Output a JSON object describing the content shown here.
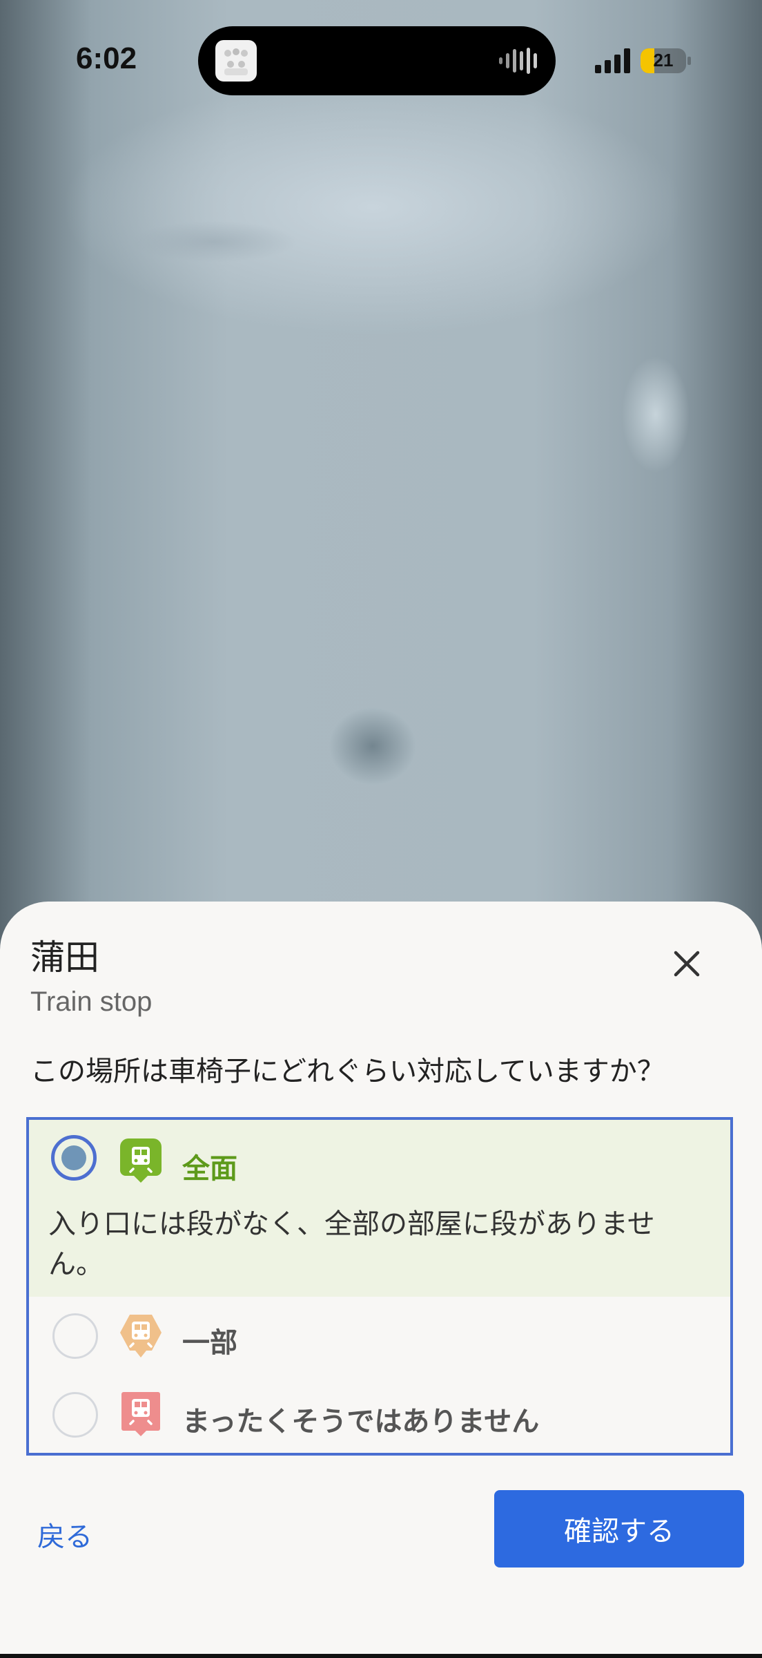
{
  "status_bar": {
    "time": "6:02",
    "battery_level": "21",
    "battery_color": "#f5c400"
  },
  "sheet": {
    "place_name": "蒲田",
    "place_type": "Train stop",
    "close_icon": "close-icon",
    "question": "この場所は車椅子にどれぐらい対応していますか？",
    "options": [
      {
        "label": "全面",
        "description": "入り口には段がなく、全部の部屋に段がありません。",
        "selected": true,
        "icon": "train-icon-green",
        "color": "#5d9a1a"
      },
      {
        "label": "一部",
        "selected": false,
        "icon": "train-icon-orange",
        "color": "#ecb275"
      },
      {
        "label": "まったくそうではありません",
        "selected": false,
        "icon": "train-icon-red",
        "color": "#ee8d8d"
      }
    ],
    "back_label": "戻る",
    "confirm_label": "確認する",
    "accent_color": "#2d6ae0"
  }
}
